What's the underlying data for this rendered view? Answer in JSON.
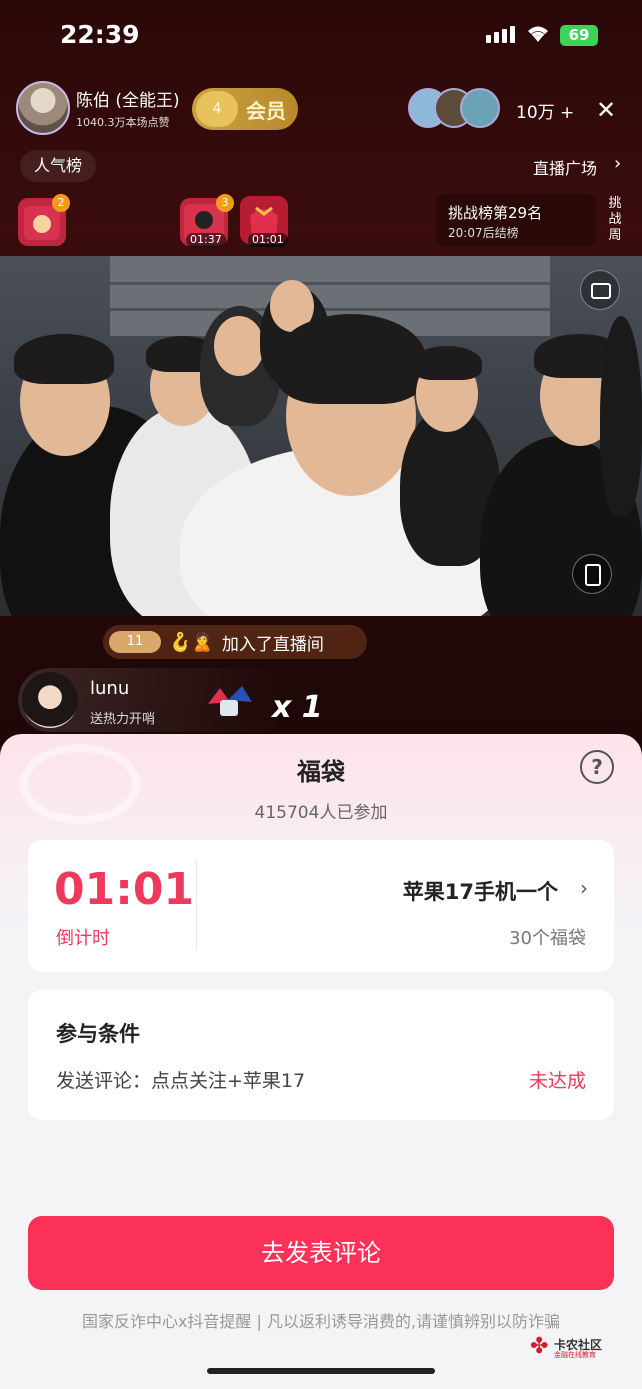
{
  "status_bar": {
    "time": "22:39",
    "battery": "69"
  },
  "header": {
    "anchor_name": "陈伯 (全能王)",
    "anchor_likes": "1040.3万本场点赞",
    "fan_level": "4",
    "fan_label": "会员",
    "viewer_count": "10万 +",
    "popularity_label": "人气榜",
    "plaza_label": "直播广场"
  },
  "gifts_row": {
    "bag1_count": "2",
    "bag2_count": "3",
    "bag2_time": "01:37",
    "bag3_time": "01:01",
    "challenge_title": "挑战榜第29名",
    "challenge_sub": "20:07后结榜",
    "challenge_week": "挑战周"
  },
  "stream": {
    "join_level": "11",
    "join_text": "加入了直播间",
    "gift_user": "lunu",
    "gift_action": "送热力开哨",
    "gift_count": "x 1"
  },
  "sheet": {
    "title": "福袋",
    "participants": "415704人已参加",
    "countdown": "01:01",
    "countdown_label": "倒计时",
    "prize_name": "苹果17手机一个",
    "prize_bags": "30个福袋",
    "condition_title": "参与条件",
    "condition_text": "发送评论：点点关注+苹果17",
    "condition_status": "未达成",
    "cta_label": "去发表评论",
    "footer_note": "国家反诈中心x抖音提醒 | 凡以返利诱导消费的,请谨慎辨别以防诈骗",
    "watermark_text": "卡农社区",
    "watermark_sub": "金融在线教育"
  },
  "colors": {
    "accent": "#fb3158",
    "countdown": "#ec3a5d"
  }
}
